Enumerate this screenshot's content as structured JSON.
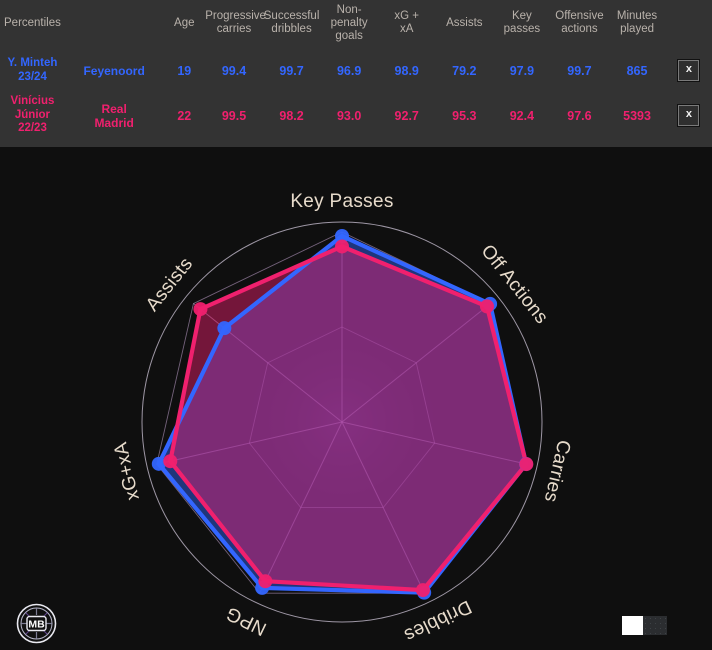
{
  "table": {
    "title": "Percentiles",
    "columns": [
      {
        "key": "name",
        "label": ""
      },
      {
        "key": "team",
        "label": ""
      },
      {
        "key": "age",
        "label": "Age"
      },
      {
        "key": "prog_carries",
        "label": "Progressive carries"
      },
      {
        "key": "succ_dribbles",
        "label": "Successful dribbles"
      },
      {
        "key": "npg",
        "label": "Non-penalty goals"
      },
      {
        "key": "xgxa",
        "label": "xG + xA"
      },
      {
        "key": "assists",
        "label": "Assists"
      },
      {
        "key": "key_passes",
        "label": "Key passes"
      },
      {
        "key": "off_actions",
        "label": "Offensive actions"
      },
      {
        "key": "minutes",
        "label": "Minutes played"
      }
    ],
    "header_lines": {
      "age": [
        "Age"
      ],
      "prog_carries": [
        "Progressive",
        "carries"
      ],
      "succ_dribbles": [
        "Successful",
        "dribbles"
      ],
      "npg": [
        "Non-",
        "penalty",
        "goals"
      ],
      "xgxa": [
        "xG +",
        "xA"
      ],
      "assists": [
        "Assists"
      ],
      "key_passes": [
        "Key",
        "passes"
      ],
      "off_actions": [
        "Offensive",
        "actions"
      ],
      "minutes": [
        "Minutes",
        "played"
      ]
    },
    "remove_label": "x",
    "rows": [
      {
        "name_lines": [
          "Y. Minteh",
          "23/24"
        ],
        "team_lines": [
          "Feyenoord"
        ],
        "color": "#3366ff",
        "age": "19",
        "prog_carries": "99.4",
        "succ_dribbles": "99.7",
        "npg": "96.9",
        "xgxa": "98.9",
        "assists": "79.2",
        "key_passes": "97.9",
        "off_actions": "99.7",
        "minutes": "865"
      },
      {
        "name_lines": [
          "Vinícius",
          "Júnior",
          "22/23"
        ],
        "team_lines": [
          "Real",
          "Madrid"
        ],
        "color": "#f0206e",
        "age": "22",
        "prog_carries": "99.5",
        "succ_dribbles": "98.2",
        "npg": "93.0",
        "xgxa": "92.7",
        "assists": "95.3",
        "key_passes": "92.4",
        "off_actions": "97.6",
        "minutes": "5393"
      }
    ]
  },
  "chart_data": {
    "type": "radar",
    "title": "",
    "center": {
      "x": 342,
      "y": 422
    },
    "radius": 190,
    "rmin": 0,
    "rmax": 100,
    "grid": true,
    "axes": [
      {
        "label": "Key Passes",
        "angle_deg": 0,
        "label_rotate": 0
      },
      {
        "label": "Off Actions",
        "angle_deg": 51.43,
        "label_rotate": 51.43
      },
      {
        "label": "Carries",
        "angle_deg": 102.86,
        "label_rotate": 102.86
      },
      {
        "label": "Dribbles",
        "angle_deg": 154.29,
        "label_rotate": 154.29
      },
      {
        "label": "NPG",
        "angle_deg": 205.71,
        "label_rotate": 205.71
      },
      {
        "label": "xG+xA",
        "angle_deg": 257.14,
        "label_rotate": 257.14
      },
      {
        "label": "Assists",
        "angle_deg": 308.57,
        "label_rotate": 308.57
      }
    ],
    "series": [
      {
        "name": "Y. Minteh 23/24",
        "color": "#3366ff",
        "fill": "#3366ff",
        "fill_opacity": 0.45,
        "values": [
          97.9,
          99.7,
          99.4,
          99.7,
          96.9,
          98.9,
          79.2
        ]
      },
      {
        "name": "Vinícius Júnior 22/23",
        "color": "#f0206e",
        "fill": "#f0206e",
        "fill_opacity": 0.45,
        "values": [
          92.4,
          97.6,
          99.5,
          98.2,
          93.0,
          92.7,
          95.3
        ]
      }
    ],
    "legend_position": "none",
    "axis_label_color": "#e7dbcb",
    "ring_color": "#cfc6d8",
    "spoke_color": "#c9a8d6",
    "background": "#0f0f0f"
  },
  "logo": {
    "text": "MB",
    "name": "mb-logo"
  },
  "toggle": {
    "state": "on",
    "on_label": "",
    "off_label": ""
  }
}
